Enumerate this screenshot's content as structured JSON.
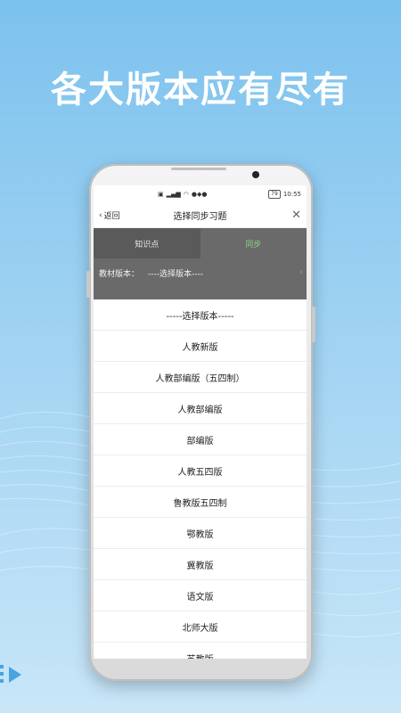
{
  "headline": "各大版本应有尽有",
  "status": {
    "icons": [
      "hd-icon",
      "signal-icon",
      "wifi-icon",
      "app-icon"
    ],
    "battery": "79",
    "time": "10:55"
  },
  "nav": {
    "back_label": "返回",
    "title": "选择同步习题"
  },
  "tabs": [
    {
      "label": "知识点"
    },
    {
      "label": "同步"
    }
  ],
  "version": {
    "label": "教材版本：",
    "value": "----选择版本----"
  },
  "options": [
    "-----选择版本-----",
    "人教新版",
    "人教部编版（五四制）",
    "人教部编版",
    "部编版",
    "人教五四版",
    "鲁教版五四制",
    "鄂教版",
    "冀教版",
    "语文版",
    "北师大版",
    "苏教版"
  ],
  "colors": {
    "background": "#9fd2f2",
    "active_tab_text": "#8bd18b",
    "overlay": "#6a6a6a"
  }
}
